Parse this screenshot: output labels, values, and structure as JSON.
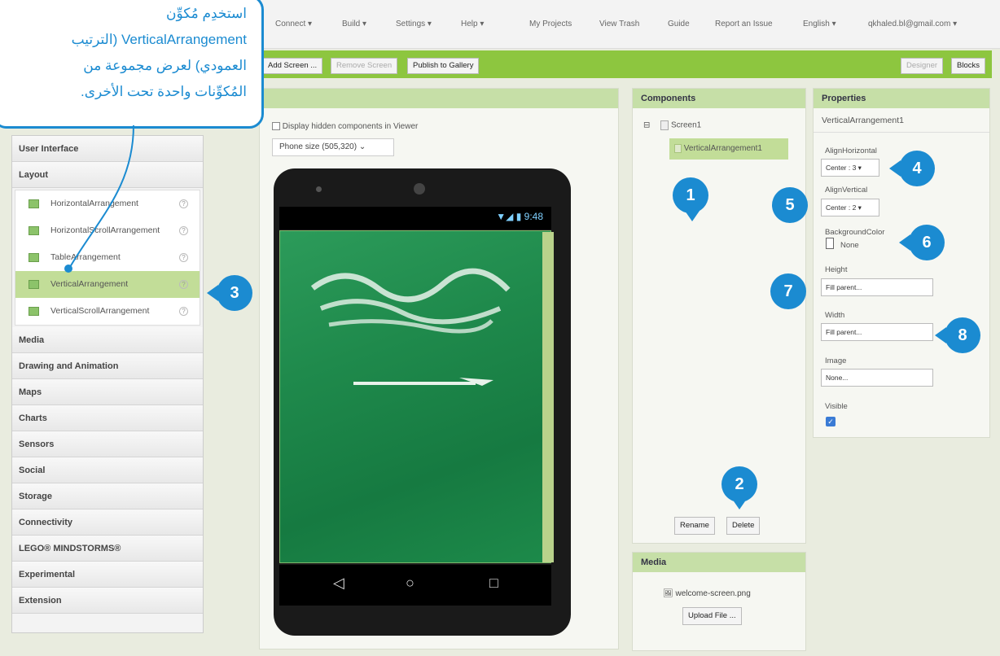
{
  "menu": {
    "connect": "Connect ▾",
    "build": "Build ▾",
    "settings": "Settings ▾",
    "help": "Help ▾",
    "my_projects": "My Projects",
    "view_trash": "View Trash",
    "guide": "Guide",
    "report": "Report an Issue",
    "language": "English ▾",
    "account": "qkhaled.bl@gmail.com ▾"
  },
  "toolbar": {
    "add_screen": "Add Screen ...",
    "remove_screen": "Remove Screen",
    "publish": "Publish to Gallery",
    "designer": "Designer",
    "blocks": "Blocks"
  },
  "palette": {
    "user_interface": "User Interface",
    "layout": "Layout",
    "layout_items": [
      "HorizontalArrangement",
      "HorizontalScrollArrangement",
      "TableArrangement",
      "VerticalArrangement",
      "VerticalScrollArrangement"
    ],
    "categories": [
      "Media",
      "Drawing and Animation",
      "Maps",
      "Charts",
      "Sensors",
      "Social",
      "Storage",
      "Connectivity",
      "LEGO® MINDSTORMS®",
      "Experimental",
      "Extension"
    ]
  },
  "viewer": {
    "hidden_label": "Display hidden components in Viewer",
    "phone_size": "Phone size (505,320)",
    "time": "9:48"
  },
  "components": {
    "title": "Components",
    "screen": "Screen1",
    "child": "VerticalArrangement1",
    "rename": "Rename",
    "delete": "Delete"
  },
  "media": {
    "title": "Media",
    "file": "welcome-screen.png",
    "upload": "Upload File ..."
  },
  "properties": {
    "title": "Properties",
    "component": "VerticalArrangement1",
    "align_h_label": "AlignHorizontal",
    "align_h_value": "Center : 3 ▾",
    "align_v_label": "AlignVertical",
    "align_v_value": "Center : 2 ▾",
    "bg_label": "BackgroundColor",
    "bg_value": "None",
    "height_label": "Height",
    "height_value": "Fill parent...",
    "width_label": "Width",
    "width_value": "Fill parent...",
    "image_label": "Image",
    "image_value": "None...",
    "visible_label": "Visible",
    "visible": true
  },
  "callouts": [
    "1",
    "2",
    "3",
    "4",
    "5",
    "6",
    "7",
    "8"
  ],
  "note": {
    "line1": "استخدِم مُكوِّن",
    "line2": "VerticalArrangement (الترتيب",
    "line3": "العمودي) لعرض مجموعة من",
    "line4": "المُكوِّنات واحدة تحت الأخرى."
  },
  "colors": {
    "accent_green": "#8dc63f",
    "callout_blue": "#1b8bd1",
    "flag_green": "#1f8a4c"
  }
}
